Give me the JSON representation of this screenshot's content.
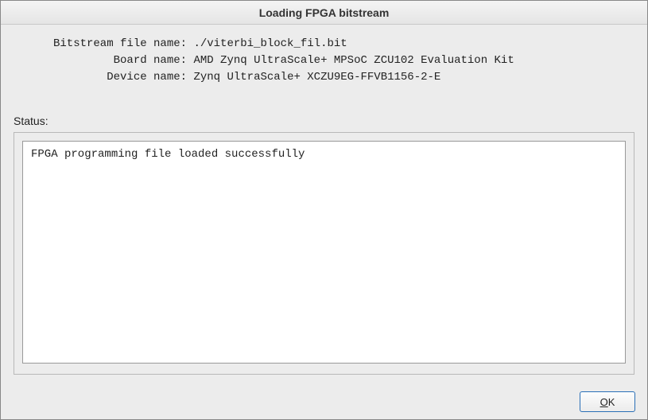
{
  "window": {
    "title": "Loading FPGA bitstream"
  },
  "info": {
    "bitstream_label": "Bitstream file name:",
    "bitstream_value": "./viterbi_block_fil.bit",
    "board_label": "Board name:",
    "board_value": "AMD Zynq UltraScale+ MPSoC ZCU102 Evaluation Kit",
    "device_label": "Device name:",
    "device_value": "Zynq UltraScale+ XCZU9EG-FFVB1156-2-E"
  },
  "status": {
    "label": "Status:",
    "message": "FPGA programming file loaded successfully"
  },
  "buttons": {
    "ok": "OK"
  }
}
